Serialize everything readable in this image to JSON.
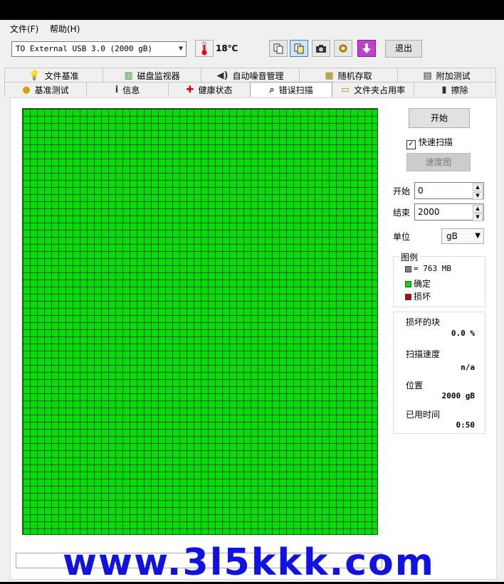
{
  "menu": {
    "file": "文件(F)",
    "help": "帮助(H)"
  },
  "toolbar": {
    "drive": "TO External USB 3.0 (2000 gB)",
    "temperature": "18℃",
    "exit_label": "退出",
    "icons": [
      "thermometer-icon",
      "copy-icon",
      "copy-all-icon",
      "camera-icon",
      "settings-icon",
      "download-icon"
    ]
  },
  "tabs_top": [
    {
      "label": "文件基准",
      "icon": "file-benchmark-icon"
    },
    {
      "label": "磁盘监视器",
      "icon": "disk-monitor-icon"
    },
    {
      "label": "自动噪音管理",
      "icon": "speaker-icon"
    },
    {
      "label": "随机存取",
      "icon": "random-access-icon"
    },
    {
      "label": "附加测试",
      "icon": "extra-tests-icon"
    }
  ],
  "tabs_bottom": [
    {
      "label": "基准测试",
      "icon": "benchmark-icon"
    },
    {
      "label": "信息",
      "icon": "info-icon"
    },
    {
      "label": "健康状态",
      "icon": "health-icon"
    },
    {
      "label": "错误扫描",
      "icon": "error-scan-icon",
      "active": true
    },
    {
      "label": "文件夹占用率",
      "icon": "folder-icon"
    },
    {
      "label": "擦除",
      "icon": "erase-icon"
    }
  ],
  "scan": {
    "start_button": "开始",
    "quick_scan_label": "快速扫描",
    "quick_scan_checked": true,
    "speed_map_button": "速度图",
    "start_label": "开始",
    "start_value": "0",
    "end_label": "结束",
    "end_value": "2000",
    "unit_label": "单位",
    "unit_value": "gB"
  },
  "legend": {
    "title": "图例",
    "block_size": "= 763 MB",
    "ok_label": "确定",
    "bad_label": "损坏",
    "colors": {
      "block": "#808080",
      "ok": "#00e000",
      "bad": "#c00000"
    }
  },
  "stats": {
    "damaged_label": "损坏的块",
    "damaged_value": "0.0 %",
    "speed_label": "扫描速度",
    "speed_value": "n/a",
    "position_label": "位置",
    "position_value": "2000 gB",
    "elapsed_label": "已用时间",
    "elapsed_value": "0:50"
  },
  "watermark": "www.3l5kkk.com"
}
